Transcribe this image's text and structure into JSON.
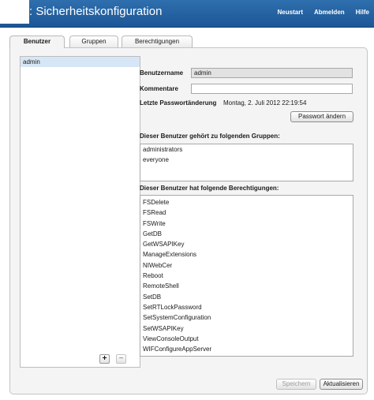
{
  "header": {
    "title": ": Sicherheitskonfiguration",
    "nav": [
      "Neustart",
      "Abmelden",
      "Hilfe"
    ]
  },
  "tabs": [
    {
      "label": "Benutzer",
      "active": true
    },
    {
      "label": "Gruppen",
      "active": false
    },
    {
      "label": "Berechtigungen",
      "active": false
    }
  ],
  "users": {
    "items": [
      "admin"
    ],
    "selected": "admin",
    "add_symbol": "+",
    "remove_symbol": "−"
  },
  "details": {
    "username_label": "Benutzername",
    "username_value": "admin",
    "comment_label": "Kommentare",
    "comment_value": "",
    "last_change_label": "Letzte Passwortänderung",
    "last_change_value": "Montag, 2. Juli 2012 22:19:54",
    "change_password_button": "Passwort ändern",
    "groups_heading": "Dieser Benutzer gehört zu folgenden Gruppen:",
    "groups": [
      "administrators",
      "everyone"
    ],
    "permissions_heading": "Dieser Benutzer hat folgende Berechtigungen:",
    "permissions": [
      "FSDelete",
      "FSRead",
      "FSWrite",
      "GetDB",
      "GetWSAPIKey",
      "ManageExtensions",
      "NIWebCer",
      "Reboot",
      "RemoteShell",
      "SetDB",
      "SetRTLockPassword",
      "SetSystemConfiguration",
      "SetWSAPIKey",
      "ViewConsoleOutput",
      "WIFConfigureAppServer"
    ]
  },
  "footer": {
    "save_button": "Speichern",
    "refresh_button": "Aktualisieren"
  }
}
